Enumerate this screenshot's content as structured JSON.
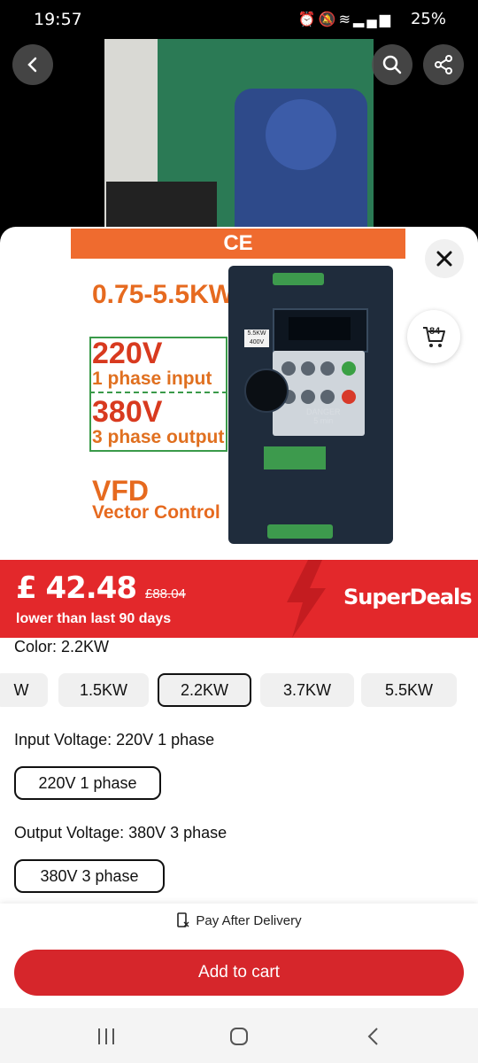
{
  "status_bar": {
    "time": "19:57",
    "status_icons": [
      "alarm-icon",
      "mute-icon",
      "wifi-icon",
      "signal-icon",
      "signal-icon"
    ],
    "battery": "25%"
  },
  "product_image": {
    "ce_mark": "CE",
    "power_range": "0.75-5.5KW",
    "input_voltage": "220V",
    "input_phase": "1 phase input",
    "output_voltage": "380V",
    "output_phase": "3 phase output",
    "type_title": "VFD",
    "type_subtitle": "Vector Control",
    "device_rating": "5.5KW 400V",
    "device_warning": "DANGER\n5 min",
    "cart_count": "84"
  },
  "price": {
    "current": "£ 42.48",
    "original": "£88.04",
    "note": "lower than last 90 days",
    "badge": "SuperDeals",
    "bar_color": "#e3282b"
  },
  "options": {
    "color_label": "Color: 2.2KW",
    "colors": [
      "W",
      "1.5KW",
      "2.2KW",
      "3.7KW",
      "5.5KW"
    ],
    "selected_color": "2.2KW",
    "input_voltage_label": "Input Voltage: 220V 1 phase",
    "input_voltage_value": "220V 1 phase",
    "output_voltage_label": "Output Voltage: 380V 3 phase",
    "output_voltage_value": "380V 3 phase"
  },
  "footer": {
    "pay_after": "Pay After Delivery",
    "add_to_cart": "Add to cart",
    "accent": "#d6262b"
  }
}
